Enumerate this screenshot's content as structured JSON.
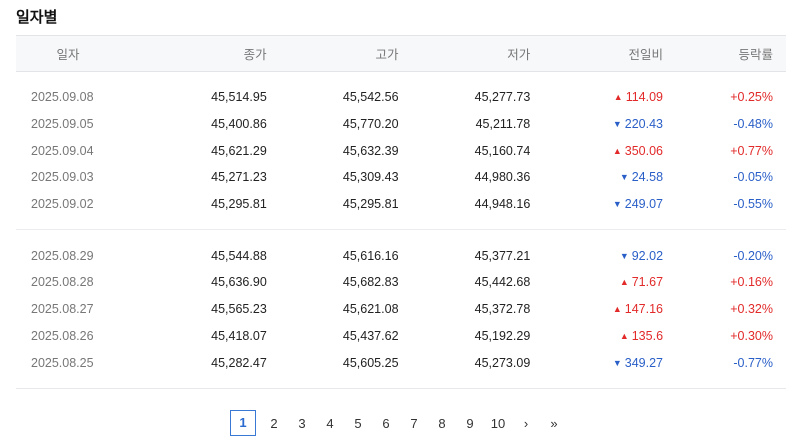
{
  "page": {
    "title": "일자별"
  },
  "table": {
    "headers": [
      "일자",
      "종가",
      "고가",
      "저가",
      "전일비",
      "등락률"
    ],
    "group_a": [
      {
        "date": "2025.09.08",
        "close": "45,514.95",
        "high": "45,542.56",
        "low": "45,277.73",
        "dir": "up",
        "diff": "114.09",
        "rate": "+0.25%"
      },
      {
        "date": "2025.09.05",
        "close": "45,400.86",
        "high": "45,770.20",
        "low": "45,211.78",
        "dir": "down",
        "diff": "220.43",
        "rate": "-0.48%"
      },
      {
        "date": "2025.09.04",
        "close": "45,621.29",
        "high": "45,632.39",
        "low": "45,160.74",
        "dir": "up",
        "diff": "350.06",
        "rate": "+0.77%"
      },
      {
        "date": "2025.09.03",
        "close": "45,271.23",
        "high": "45,309.43",
        "low": "44,980.36",
        "dir": "down",
        "diff": "24.58",
        "rate": "-0.05%"
      },
      {
        "date": "2025.09.02",
        "close": "45,295.81",
        "high": "45,295.81",
        "low": "44,948.16",
        "dir": "down",
        "diff": "249.07",
        "rate": "-0.55%"
      }
    ],
    "group_b": [
      {
        "date": "2025.08.29",
        "close": "45,544.88",
        "high": "45,616.16",
        "low": "45,377.21",
        "dir": "down",
        "diff": "92.02",
        "rate": "-0.20%"
      },
      {
        "date": "2025.08.28",
        "close": "45,636.90",
        "high": "45,682.83",
        "low": "45,442.68",
        "dir": "up",
        "diff": "71.67",
        "rate": "+0.16%"
      },
      {
        "date": "2025.08.27",
        "close": "45,565.23",
        "high": "45,621.08",
        "low": "45,372.78",
        "dir": "up",
        "diff": "147.16",
        "rate": "+0.32%"
      },
      {
        "date": "2025.08.26",
        "close": "45,418.07",
        "high": "45,437.62",
        "low": "45,192.29",
        "dir": "up",
        "diff": "135.6",
        "rate": "+0.30%"
      },
      {
        "date": "2025.08.25",
        "close": "45,282.47",
        "high": "45,605.25",
        "low": "45,273.09",
        "dir": "down",
        "diff": "349.27",
        "rate": "-0.77%"
      }
    ]
  },
  "pagination": {
    "pages": [
      "1",
      "2",
      "3",
      "4",
      "5",
      "6",
      "7",
      "8",
      "9",
      "10"
    ],
    "current": "1",
    "next_icon": "chevron-right-icon",
    "next_glyph": "›",
    "last_icon": "double-chevron-right-icon",
    "last_glyph": "»"
  },
  "colors": {
    "up": "#e22a2a",
    "down": "#2a5fc8"
  },
  "glyphs": {
    "up": "▲",
    "down": "▼"
  }
}
